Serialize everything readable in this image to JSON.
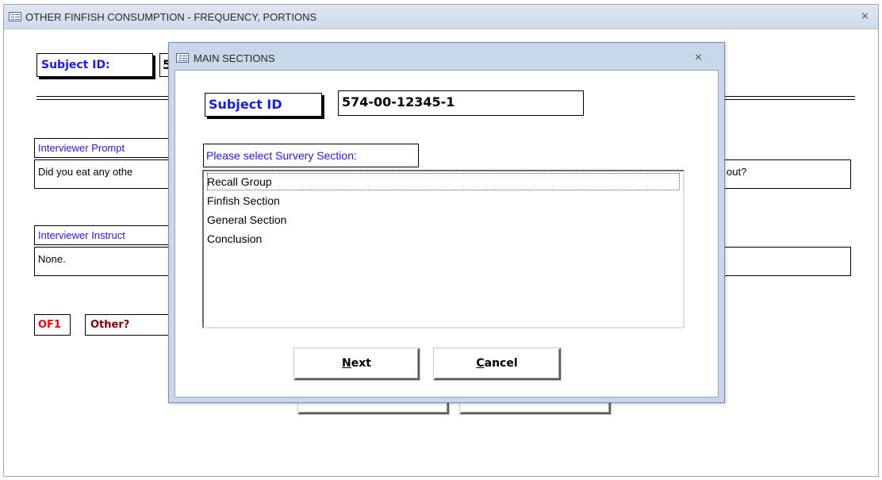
{
  "background_form": {
    "title": "OTHER FINFISH CONSUMPTION - FREQUENCY, PORTIONS",
    "subject_id_label": "Subject ID:",
    "subject_id_value_partial": "5",
    "interviewer_prompt_label": "Interviewer Prompt",
    "prompt_text": "Did you eat any othe",
    "prompt_text_right": "out?",
    "interviewer_instructions_label": "Interviewer Instruct",
    "instructions_text": "None.",
    "question_code": "OF1",
    "question_label": "Other?",
    "colors": {
      "label_blue": "#1a1aff",
      "code_red": "#ff0000",
      "label_maroon": "#800000"
    }
  },
  "dialog": {
    "title": "MAIN SECTIONS",
    "subject_id_label": "Subject ID",
    "subject_id_value": "574-00-12345-1",
    "select_prompt": "Please select Survery Section:",
    "sections": [
      "Recall Group",
      "Finfish Section",
      "General Section",
      "Conclusion"
    ],
    "selected_index": 0,
    "next_button": {
      "prefix": "",
      "accel": "N",
      "rest": "ext"
    },
    "cancel_button": {
      "prefix": "",
      "accel": "C",
      "rest": "ancel"
    }
  },
  "icons": {
    "window_icon": "form-icon",
    "close_icon": "close-icon"
  }
}
